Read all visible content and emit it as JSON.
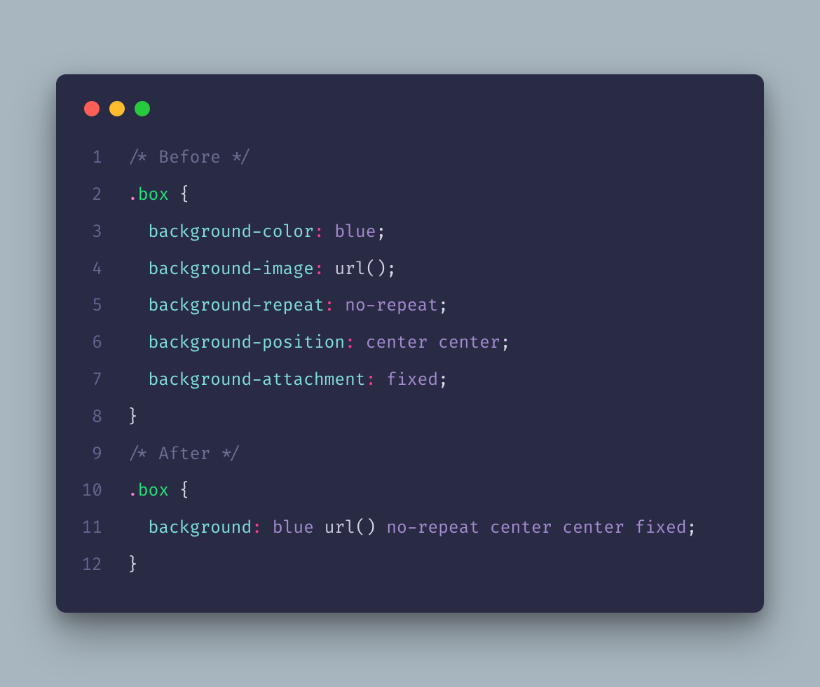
{
  "window": {
    "traffic_lights": [
      "red",
      "yellow",
      "green"
    ]
  },
  "code": {
    "lines": [
      {
        "n": 1,
        "indent": 0,
        "tokens": [
          {
            "t": "comment",
            "v": "/* Before */"
          }
        ]
      },
      {
        "n": 2,
        "indent": 0,
        "tokens": [
          {
            "t": "dot",
            "v": "."
          },
          {
            "t": "class",
            "v": "box"
          },
          {
            "t": "plain",
            "v": " "
          },
          {
            "t": "brace",
            "v": "{"
          }
        ]
      },
      {
        "n": 3,
        "indent": 1,
        "tokens": [
          {
            "t": "prop",
            "v": "background-color"
          },
          {
            "t": "colon",
            "v": ":"
          },
          {
            "t": "plain",
            "v": " "
          },
          {
            "t": "value",
            "v": "blue"
          },
          {
            "t": "semi",
            "v": ";"
          }
        ]
      },
      {
        "n": 4,
        "indent": 1,
        "tokens": [
          {
            "t": "prop",
            "v": "background-image"
          },
          {
            "t": "colon",
            "v": ":"
          },
          {
            "t": "plain",
            "v": " "
          },
          {
            "t": "fn",
            "v": "url"
          },
          {
            "t": "paren",
            "v": "()"
          },
          {
            "t": "semi",
            "v": ";"
          }
        ]
      },
      {
        "n": 5,
        "indent": 1,
        "tokens": [
          {
            "t": "prop",
            "v": "background-repeat"
          },
          {
            "t": "colon",
            "v": ":"
          },
          {
            "t": "plain",
            "v": " "
          },
          {
            "t": "value",
            "v": "no-repeat"
          },
          {
            "t": "semi",
            "v": ";"
          }
        ]
      },
      {
        "n": 6,
        "indent": 1,
        "tokens": [
          {
            "t": "prop",
            "v": "background-position"
          },
          {
            "t": "colon",
            "v": ":"
          },
          {
            "t": "plain",
            "v": " "
          },
          {
            "t": "value",
            "v": "center center"
          },
          {
            "t": "semi",
            "v": ";"
          }
        ]
      },
      {
        "n": 7,
        "indent": 1,
        "tokens": [
          {
            "t": "prop",
            "v": "background-attachment"
          },
          {
            "t": "colon",
            "v": ":"
          },
          {
            "t": "plain",
            "v": " "
          },
          {
            "t": "value",
            "v": "fixed"
          },
          {
            "t": "semi",
            "v": ";"
          }
        ]
      },
      {
        "n": 8,
        "indent": 0,
        "tokens": [
          {
            "t": "brace",
            "v": "}"
          }
        ]
      },
      {
        "n": 9,
        "indent": 0,
        "tokens": [
          {
            "t": "comment",
            "v": "/* After */"
          }
        ]
      },
      {
        "n": 10,
        "indent": 0,
        "tokens": [
          {
            "t": "dot",
            "v": "."
          },
          {
            "t": "class",
            "v": "box"
          },
          {
            "t": "plain",
            "v": " "
          },
          {
            "t": "brace",
            "v": "{"
          }
        ]
      },
      {
        "n": 11,
        "indent": 1,
        "tokens": [
          {
            "t": "prop",
            "v": "background"
          },
          {
            "t": "colon",
            "v": ":"
          },
          {
            "t": "plain",
            "v": " "
          },
          {
            "t": "value",
            "v": "blue "
          },
          {
            "t": "fn",
            "v": "url"
          },
          {
            "t": "paren",
            "v": "()"
          },
          {
            "t": "value",
            "v": " no-repeat center center fixed"
          },
          {
            "t": "semi",
            "v": ";"
          }
        ]
      },
      {
        "n": 12,
        "indent": 0,
        "tokens": [
          {
            "t": "brace",
            "v": "}"
          }
        ]
      }
    ]
  }
}
